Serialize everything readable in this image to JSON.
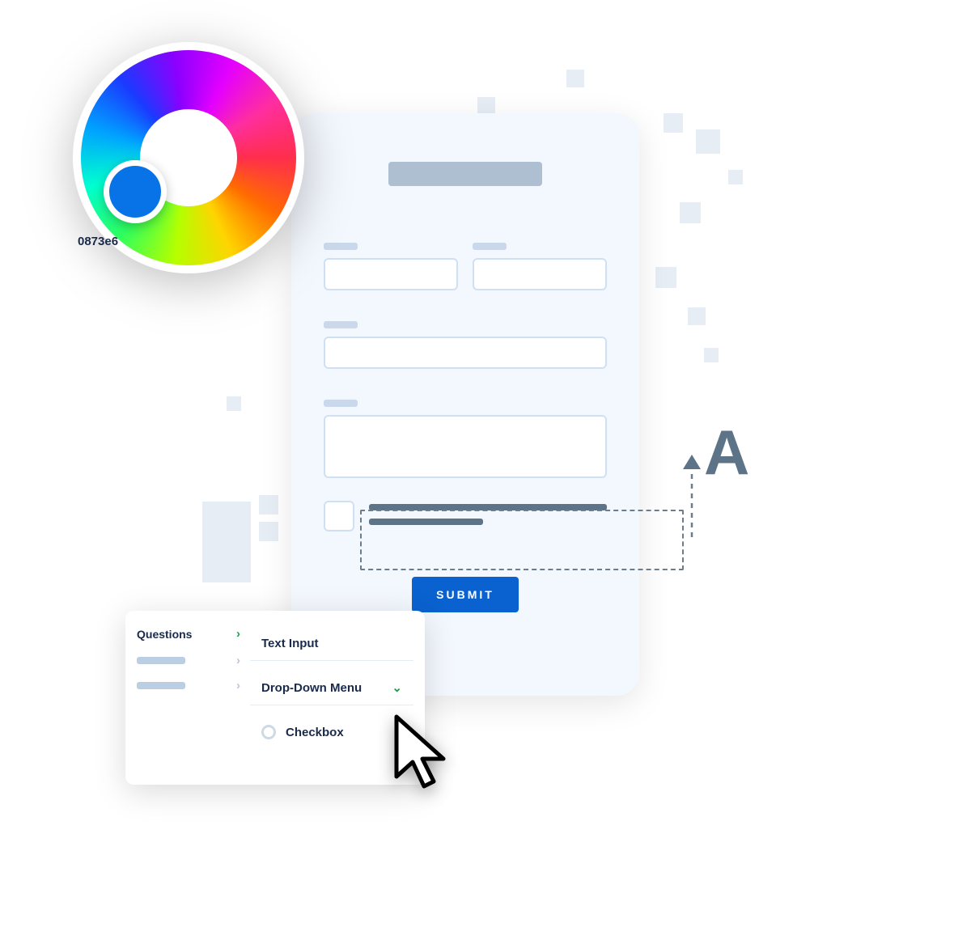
{
  "colorpicker": {
    "hex": "0873e6",
    "swatch_color": "#0873e6"
  },
  "form": {
    "submit_label": "SUBMIT"
  },
  "questions_panel": {
    "heading": "Questions",
    "items": [
      {
        "label": "Text Input"
      },
      {
        "label": "Drop-Down Menu"
      },
      {
        "label": "Checkbox"
      }
    ]
  },
  "font_demo": {
    "big_glyph": "A"
  },
  "colors": {
    "accent": "#0a62d0",
    "swatch": "#0873e6",
    "panel_bg": "#f3f8fe",
    "outline": "#cfe0f5",
    "slate": "#5d7388"
  }
}
